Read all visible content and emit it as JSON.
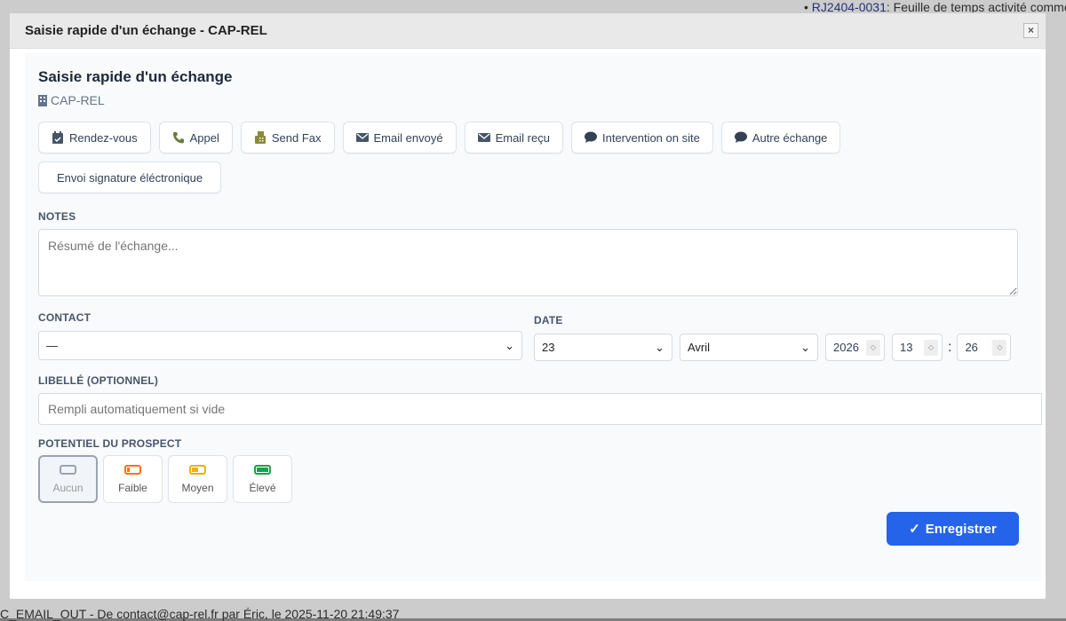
{
  "background": {
    "top_link": "RJ2404-0031",
    "top_text": ": Feuille de temps activité comme",
    "bottom_text": "C_EMAIL_OUT - De contact@cap-rel.fr par Éric, le 2025-11-20 21:49:37"
  },
  "modal": {
    "title": "Saisie rapide d'un échange - CAP-REL",
    "close": "×"
  },
  "form": {
    "heading": "Saisie rapide d'un échange",
    "company": "CAP-REL",
    "types": [
      {
        "label": "Rendez-vous",
        "icon": "calendar-check-icon"
      },
      {
        "label": "Appel",
        "icon": "phone-icon"
      },
      {
        "label": "Send Fax",
        "icon": "fax-icon"
      },
      {
        "label": "Email envoyé",
        "icon": "envelope-icon"
      },
      {
        "label": "Email reçu",
        "icon": "envelope-icon"
      },
      {
        "label": "Intervention on site",
        "icon": "comment-icon"
      },
      {
        "label": "Autre échange",
        "icon": "comment-icon"
      },
      {
        "label": "Envoi signature éléctronique",
        "icon": ""
      }
    ],
    "notes_label": "NOTES",
    "notes_placeholder": "Résumé de l'échange...",
    "contact_label": "CONTACT",
    "contact_value": "—",
    "date_label": "DATE",
    "day": "23",
    "month": "Avril",
    "year": "2026",
    "hour": "13",
    "minute": "26",
    "time_sep": ":",
    "libelle_label": "LIBELLÉ (OPTIONNEL)",
    "libelle_placeholder": "Rempli automatiquement si vide",
    "potential_label": "POTENTIEL DU PROSPECT",
    "potential": [
      {
        "label": "Aucun",
        "color": "#9ca3af",
        "level": 0,
        "selected": true
      },
      {
        "label": "Faible",
        "color": "#f97316",
        "level": 0.25
      },
      {
        "label": "Moyen",
        "color": "#eab308",
        "level": 0.5
      },
      {
        "label": "Élevé",
        "color": "#16a34a",
        "level": 1
      }
    ],
    "save_label": "Enregistrer"
  }
}
